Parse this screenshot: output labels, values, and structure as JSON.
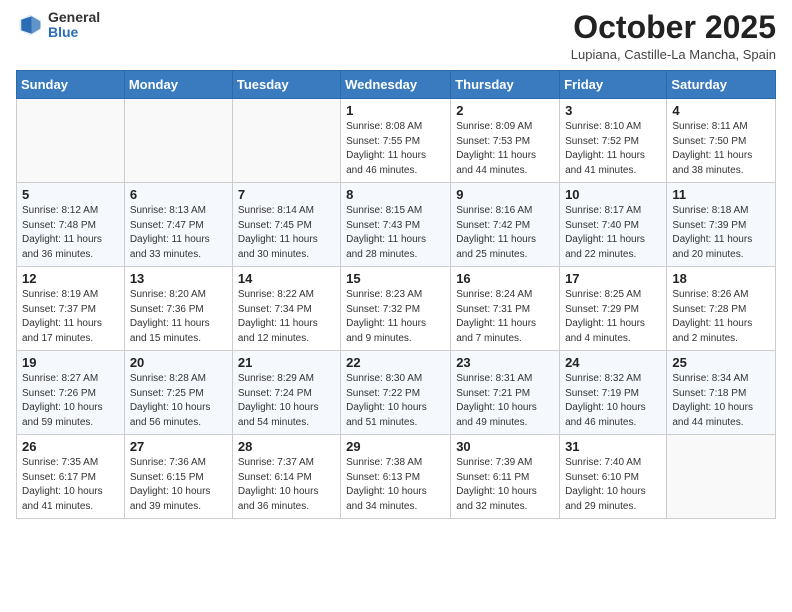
{
  "header": {
    "logo_general": "General",
    "logo_blue": "Blue",
    "month": "October 2025",
    "location": "Lupiana, Castille-La Mancha, Spain"
  },
  "days_of_week": [
    "Sunday",
    "Monday",
    "Tuesday",
    "Wednesday",
    "Thursday",
    "Friday",
    "Saturday"
  ],
  "weeks": [
    [
      {
        "day": "",
        "info": ""
      },
      {
        "day": "",
        "info": ""
      },
      {
        "day": "",
        "info": ""
      },
      {
        "day": "1",
        "info": "Sunrise: 8:08 AM\nSunset: 7:55 PM\nDaylight: 11 hours and 46 minutes."
      },
      {
        "day": "2",
        "info": "Sunrise: 8:09 AM\nSunset: 7:53 PM\nDaylight: 11 hours and 44 minutes."
      },
      {
        "day": "3",
        "info": "Sunrise: 8:10 AM\nSunset: 7:52 PM\nDaylight: 11 hours and 41 minutes."
      },
      {
        "day": "4",
        "info": "Sunrise: 8:11 AM\nSunset: 7:50 PM\nDaylight: 11 hours and 38 minutes."
      }
    ],
    [
      {
        "day": "5",
        "info": "Sunrise: 8:12 AM\nSunset: 7:48 PM\nDaylight: 11 hours and 36 minutes."
      },
      {
        "day": "6",
        "info": "Sunrise: 8:13 AM\nSunset: 7:47 PM\nDaylight: 11 hours and 33 minutes."
      },
      {
        "day": "7",
        "info": "Sunrise: 8:14 AM\nSunset: 7:45 PM\nDaylight: 11 hours and 30 minutes."
      },
      {
        "day": "8",
        "info": "Sunrise: 8:15 AM\nSunset: 7:43 PM\nDaylight: 11 hours and 28 minutes."
      },
      {
        "day": "9",
        "info": "Sunrise: 8:16 AM\nSunset: 7:42 PM\nDaylight: 11 hours and 25 minutes."
      },
      {
        "day": "10",
        "info": "Sunrise: 8:17 AM\nSunset: 7:40 PM\nDaylight: 11 hours and 22 minutes."
      },
      {
        "day": "11",
        "info": "Sunrise: 8:18 AM\nSunset: 7:39 PM\nDaylight: 11 hours and 20 minutes."
      }
    ],
    [
      {
        "day": "12",
        "info": "Sunrise: 8:19 AM\nSunset: 7:37 PM\nDaylight: 11 hours and 17 minutes."
      },
      {
        "day": "13",
        "info": "Sunrise: 8:20 AM\nSunset: 7:36 PM\nDaylight: 11 hours and 15 minutes."
      },
      {
        "day": "14",
        "info": "Sunrise: 8:22 AM\nSunset: 7:34 PM\nDaylight: 11 hours and 12 minutes."
      },
      {
        "day": "15",
        "info": "Sunrise: 8:23 AM\nSunset: 7:32 PM\nDaylight: 11 hours and 9 minutes."
      },
      {
        "day": "16",
        "info": "Sunrise: 8:24 AM\nSunset: 7:31 PM\nDaylight: 11 hours and 7 minutes."
      },
      {
        "day": "17",
        "info": "Sunrise: 8:25 AM\nSunset: 7:29 PM\nDaylight: 11 hours and 4 minutes."
      },
      {
        "day": "18",
        "info": "Sunrise: 8:26 AM\nSunset: 7:28 PM\nDaylight: 11 hours and 2 minutes."
      }
    ],
    [
      {
        "day": "19",
        "info": "Sunrise: 8:27 AM\nSunset: 7:26 PM\nDaylight: 10 hours and 59 minutes."
      },
      {
        "day": "20",
        "info": "Sunrise: 8:28 AM\nSunset: 7:25 PM\nDaylight: 10 hours and 56 minutes."
      },
      {
        "day": "21",
        "info": "Sunrise: 8:29 AM\nSunset: 7:24 PM\nDaylight: 10 hours and 54 minutes."
      },
      {
        "day": "22",
        "info": "Sunrise: 8:30 AM\nSunset: 7:22 PM\nDaylight: 10 hours and 51 minutes."
      },
      {
        "day": "23",
        "info": "Sunrise: 8:31 AM\nSunset: 7:21 PM\nDaylight: 10 hours and 49 minutes."
      },
      {
        "day": "24",
        "info": "Sunrise: 8:32 AM\nSunset: 7:19 PM\nDaylight: 10 hours and 46 minutes."
      },
      {
        "day": "25",
        "info": "Sunrise: 8:34 AM\nSunset: 7:18 PM\nDaylight: 10 hours and 44 minutes."
      }
    ],
    [
      {
        "day": "26",
        "info": "Sunrise: 7:35 AM\nSunset: 6:17 PM\nDaylight: 10 hours and 41 minutes."
      },
      {
        "day": "27",
        "info": "Sunrise: 7:36 AM\nSunset: 6:15 PM\nDaylight: 10 hours and 39 minutes."
      },
      {
        "day": "28",
        "info": "Sunrise: 7:37 AM\nSunset: 6:14 PM\nDaylight: 10 hours and 36 minutes."
      },
      {
        "day": "29",
        "info": "Sunrise: 7:38 AM\nSunset: 6:13 PM\nDaylight: 10 hours and 34 minutes."
      },
      {
        "day": "30",
        "info": "Sunrise: 7:39 AM\nSunset: 6:11 PM\nDaylight: 10 hours and 32 minutes."
      },
      {
        "day": "31",
        "info": "Sunrise: 7:40 AM\nSunset: 6:10 PM\nDaylight: 10 hours and 29 minutes."
      },
      {
        "day": "",
        "info": ""
      }
    ]
  ]
}
